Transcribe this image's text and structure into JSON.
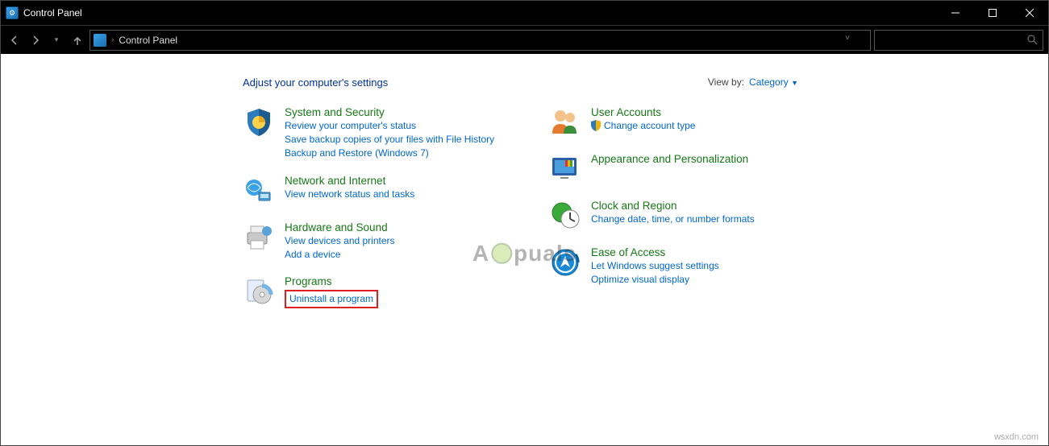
{
  "window": {
    "title": "Control Panel"
  },
  "breadcrumb": {
    "root": "Control Panel"
  },
  "page": {
    "heading": "Adjust your computer's settings",
    "view_by_label": "View by:",
    "view_by_value": "Category"
  },
  "categories": {
    "left": [
      {
        "id": "system-security",
        "title": "System and Security",
        "links": [
          "Review your computer's status",
          "Save backup copies of your files with File History",
          "Backup and Restore (Windows 7)"
        ]
      },
      {
        "id": "network-internet",
        "title": "Network and Internet",
        "links": [
          "View network status and tasks"
        ]
      },
      {
        "id": "hardware-sound",
        "title": "Hardware and Sound",
        "links": [
          "View devices and printers",
          "Add a device"
        ]
      },
      {
        "id": "programs",
        "title": "Programs",
        "links": [
          "Uninstall a program"
        ],
        "highlight_link": 0
      }
    ],
    "right": [
      {
        "id": "user-accounts",
        "title": "User Accounts",
        "links": [
          "Change account type"
        ],
        "shield_link": 0
      },
      {
        "id": "appearance",
        "title": "Appearance and Personalization",
        "links": []
      },
      {
        "id": "clock-region",
        "title": "Clock and Region",
        "links": [
          "Change date, time, or number formats"
        ]
      },
      {
        "id": "ease-of-access",
        "title": "Ease of Access",
        "links": [
          "Let Windows suggest settings",
          "Optimize visual display"
        ]
      }
    ]
  },
  "watermark": {
    "pre": "A",
    "post": "puals"
  },
  "footer": {
    "text": "wsxdn.com"
  }
}
